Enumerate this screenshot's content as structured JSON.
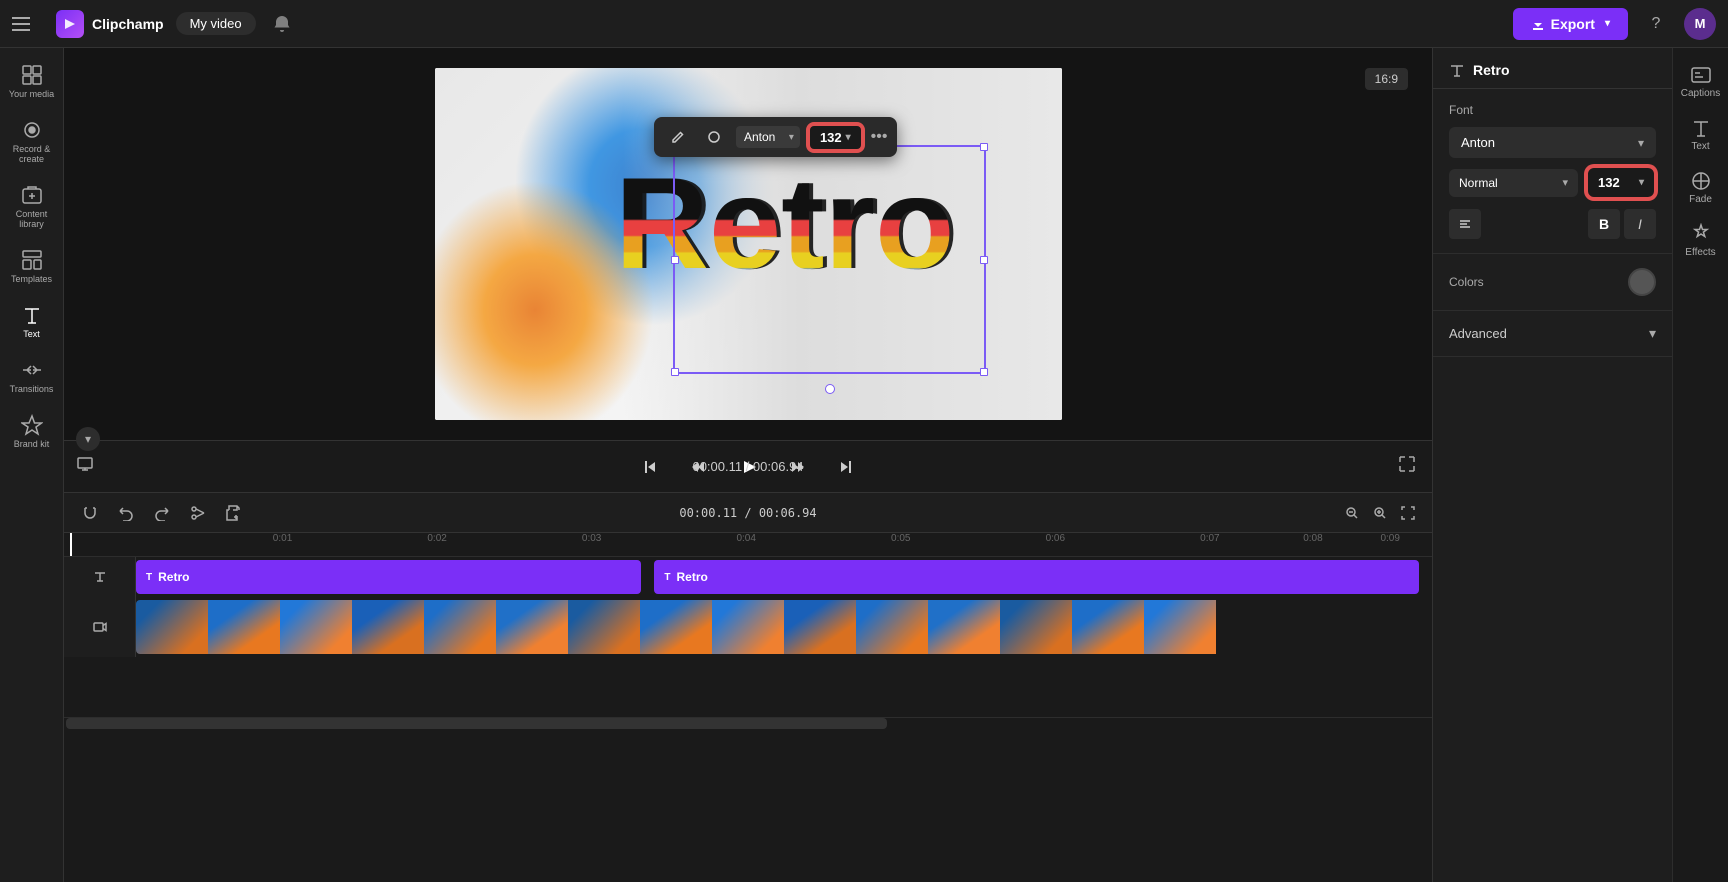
{
  "app": {
    "name": "Clipchamp",
    "project_name": "My video",
    "export_label": "Export",
    "help_label": "?",
    "avatar_initials": "M"
  },
  "sidebar": {
    "items": [
      {
        "id": "your-media",
        "label": "Your media",
        "icon": "grid"
      },
      {
        "id": "record-create",
        "label": "Record & create",
        "icon": "record"
      },
      {
        "id": "content-library",
        "label": "Content library",
        "icon": "library"
      },
      {
        "id": "templates",
        "label": "Templates",
        "icon": "templates"
      },
      {
        "id": "text",
        "label": "Text",
        "icon": "text"
      },
      {
        "id": "transitions",
        "label": "Transitions",
        "icon": "transitions"
      },
      {
        "id": "brand-kit",
        "label": "Brand kit",
        "icon": "brand"
      }
    ]
  },
  "preview": {
    "aspect_ratio": "16:9",
    "canvas_text": "Retro"
  },
  "text_toolbar": {
    "font": "Anton",
    "size": "132",
    "more_label": "•••"
  },
  "playback": {
    "current_time": "00:00.11",
    "total_time": "00:06.94",
    "time_display": "00:00.11 / 00:06.94"
  },
  "timeline": {
    "ruler_marks": [
      "0:01",
      "0:02",
      "0:03",
      "0:04",
      "0:05",
      "0:06",
      "0:07",
      "0:08",
      "0:09"
    ],
    "time_code": "00:00.11 / 00:06.94"
  },
  "clips": [
    {
      "id": "clip1",
      "label": "Retro",
      "type": "text"
    },
    {
      "id": "clip2",
      "label": "Retro",
      "type": "text"
    }
  ],
  "right_panel": {
    "title": "Retro",
    "font_section_label": "Font",
    "font_name": "Anton",
    "font_style": "Normal",
    "font_size": "132",
    "font_size_arrow": "▾",
    "bold_label": "B",
    "italic_label": "I",
    "colors_section_label": "Colors",
    "advanced_section_label": "Advanced"
  },
  "far_right": {
    "items": [
      {
        "id": "captions",
        "label": "Captions"
      },
      {
        "id": "text-tool",
        "label": "Text"
      },
      {
        "id": "fade",
        "label": "Fade"
      },
      {
        "id": "effects",
        "label": "Effects"
      }
    ]
  }
}
